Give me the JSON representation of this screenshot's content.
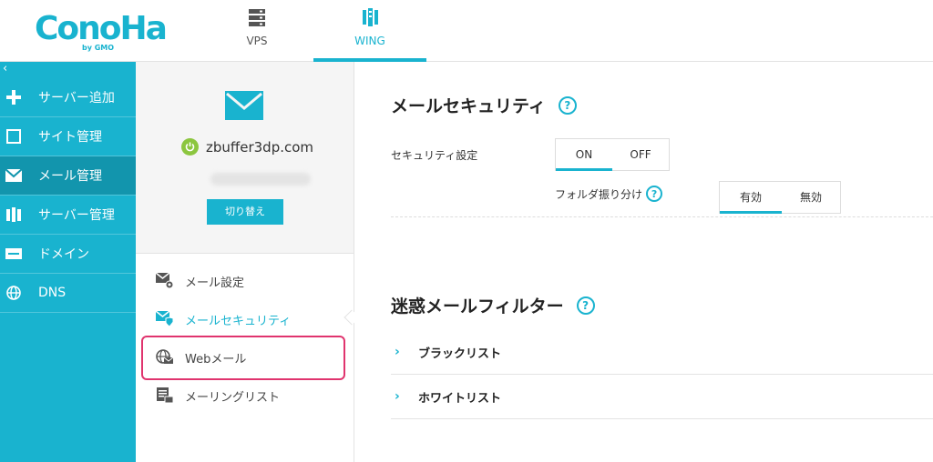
{
  "brand": {
    "logo_text": "ConoHa",
    "logo_sub": "by GMO",
    "accent": "#19b3cf"
  },
  "top_tabs": [
    {
      "label": "VPS",
      "icon": "server-stack-icon"
    },
    {
      "label": "WING",
      "icon": "wing-server-icon"
    }
  ],
  "sidebar": {
    "collapse_glyph": "‹",
    "items": [
      {
        "label": "サーバー追加",
        "icon": "plus-icon"
      },
      {
        "label": "サイト管理",
        "icon": "site-icon"
      },
      {
        "label": "メール管理",
        "icon": "mail-icon"
      },
      {
        "label": "サーバー管理",
        "icon": "server-icon"
      },
      {
        "label": "ドメイン",
        "icon": "domain-icon"
      },
      {
        "label": "DNS",
        "icon": "globe-icon"
      }
    ]
  },
  "domain_panel": {
    "domain": "zbuffer3dp.com",
    "switch_label": "切り替え",
    "menu": [
      {
        "label": "メール設定",
        "icon": "mail-settings-icon"
      },
      {
        "label": "メールセキュリティ",
        "icon": "mail-security-icon"
      },
      {
        "label": "Webメール",
        "icon": "webmail-icon"
      },
      {
        "label": "メーリングリスト",
        "icon": "mailing-list-icon"
      }
    ]
  },
  "mail_security": {
    "title": "メールセキュリティ",
    "help": "?",
    "security_label": "セキュリティ設定",
    "security_options": [
      "ON",
      "OFF"
    ],
    "security_selected": "ON",
    "folder_label": "フォルダ振り分け",
    "folder_options": [
      "有効",
      "無効"
    ],
    "folder_selected": "有効"
  },
  "spam_filter": {
    "title": "迷惑メールフィルター",
    "help": "?",
    "items": [
      {
        "label": "ブラックリスト",
        "chevron": "›"
      },
      {
        "label": "ホワイトリスト",
        "chevron": "›"
      }
    ]
  }
}
